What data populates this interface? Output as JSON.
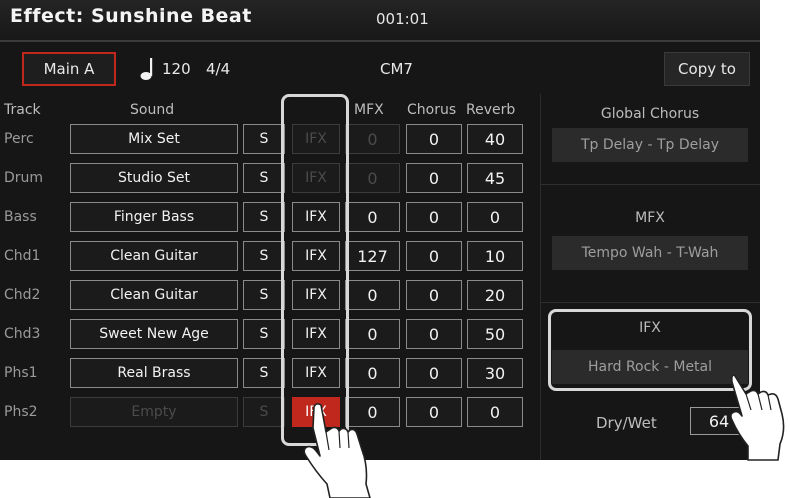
{
  "title": {
    "effect": "Effect:  Sunshine Beat",
    "position": "001:01"
  },
  "toolbar": {
    "section": "Main A",
    "tempo": "120",
    "time_signature": "4/4",
    "chord": "CM7",
    "copy_label": "Copy to",
    "tempo_icon": "quarter-note-icon"
  },
  "columns": {
    "track": "Track",
    "sound": "Sound",
    "mfx": "MFX",
    "chorus": "Chorus",
    "reverb": "Reverb"
  },
  "rows": [
    {
      "track": "Perc",
      "sound": "Mix Set",
      "solo": "S",
      "ifx": "IFX",
      "mfx": "0",
      "chorus": "0",
      "reverb": "40"
    },
    {
      "track": "Drum",
      "sound": "Studio Set",
      "solo": "S",
      "ifx": "IFX",
      "mfx": "0",
      "chorus": "0",
      "reverb": "45"
    },
    {
      "track": "Bass",
      "sound": "Finger Bass",
      "solo": "S",
      "ifx": "IFX",
      "mfx": "0",
      "chorus": "0",
      "reverb": "0"
    },
    {
      "track": "Chd1",
      "sound": "Clean Guitar",
      "solo": "S",
      "ifx": "IFX",
      "mfx": "127",
      "chorus": "0",
      "reverb": "10"
    },
    {
      "track": "Chd2",
      "sound": "Clean Guitar",
      "solo": "S",
      "ifx": "IFX",
      "mfx": "0",
      "chorus": "0",
      "reverb": "20"
    },
    {
      "track": "Chd3",
      "sound": "Sweet New Age",
      "solo": "S",
      "ifx": "IFX",
      "mfx": "0",
      "chorus": "0",
      "reverb": "50"
    },
    {
      "track": "Phs1",
      "sound": "Real Brass",
      "solo": "S",
      "ifx": "IFX",
      "mfx": "0",
      "chorus": "0",
      "reverb": "30"
    },
    {
      "track": "Phs2",
      "sound": "Empty",
      "solo": "S",
      "ifx": "IFX",
      "mfx": "0",
      "chorus": "0",
      "reverb": "0"
    }
  ],
  "panel": {
    "global_chorus": {
      "title": "Global Chorus",
      "value": "Tp Delay - Tp Delay"
    },
    "mfx": {
      "title": "MFX",
      "value": "Tempo Wah - T-Wah"
    },
    "ifx": {
      "title": "IFX",
      "value": "Hard Rock - Metal"
    },
    "drywet": {
      "label": "Dry/Wet",
      "value": "64"
    }
  },
  "colors": {
    "accent": "#c0271d",
    "background": "#161616",
    "highlight_frame": "#d8d8d8"
  },
  "icons": [
    "quarter-note-icon",
    "pointing-hand-icon"
  ]
}
